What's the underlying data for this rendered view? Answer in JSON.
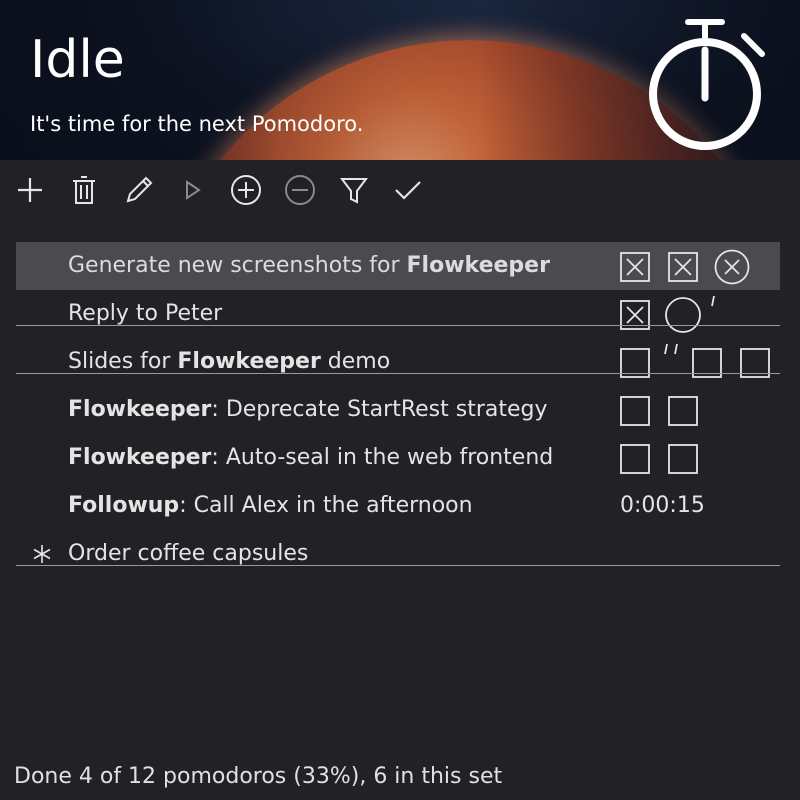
{
  "header": {
    "status": "Idle",
    "message": "It's time for the next Pomodoro."
  },
  "toolbar": {
    "buttons": [
      "add-icon",
      "delete-icon",
      "rename-icon",
      "start-icon",
      "add-pomodoro-icon",
      "remove-pomodoro-icon",
      "filter-icon",
      "complete-icon"
    ]
  },
  "tasks": [
    {
      "prefix": "Generate new screenshots for ",
      "bold": "Flowkeeper",
      "suffix": "",
      "pomodoros": [
        "done",
        "done",
        "voided"
      ],
      "selected": true
    },
    {
      "prefix": "Reply to Peter",
      "bold": "",
      "suffix": "",
      "pomodoros": [
        "done",
        "running",
        "interruption-mark"
      ],
      "completed": true
    },
    {
      "prefix": "Slides for ",
      "bold": "Flowkeeper",
      "suffix": " demo",
      "pomodoros": [
        "new",
        "interruption-mark-double",
        "new",
        "new"
      ],
      "completed": true
    },
    {
      "prefix": "",
      "bold": "Flowkeeper",
      "suffix": ": Deprecate StartRest strategy",
      "pomodoros": [
        "new",
        "new"
      ]
    },
    {
      "prefix": "",
      "bold": "Flowkeeper",
      "suffix": ": Auto-seal in the web frontend",
      "pomodoros": [
        "new",
        "new"
      ]
    },
    {
      "prefix": "",
      "bold": "Followup",
      "suffix": ": Call Alex in the afternoon",
      "timer": "0:00:15"
    },
    {
      "prefix": "Order coffee capsules",
      "bold": "",
      "suffix": "",
      "star": "asterisk-icon",
      "completed": true
    }
  ],
  "footer": {
    "summary": "Done 4 of 12 pomodoros (33%), 6 in this set"
  }
}
